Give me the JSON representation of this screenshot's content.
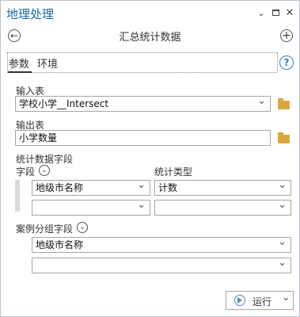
{
  "window": {
    "title": "地理处理"
  },
  "header": {
    "tool_title": "汇总统计数据"
  },
  "tabs": [
    {
      "label": "参数"
    },
    {
      "label": "环境"
    }
  ],
  "params": {
    "input_table": {
      "label": "输入表",
      "value": "学校小学__Intersect"
    },
    "output_table": {
      "label": "输出表",
      "value": "小学数量"
    },
    "stat_fields": {
      "label": "统计数据字段",
      "field_header": "字段",
      "type_header": "统计类型",
      "rows": [
        {
          "field": "地级市名称",
          "type": "计数"
        },
        {
          "field": "",
          "type": ""
        }
      ]
    },
    "case_field": {
      "label": "案例分组字段",
      "rows": [
        {
          "value": "地级市名称"
        },
        {
          "value": ""
        }
      ]
    }
  },
  "footer": {
    "run_label": "运行"
  },
  "icons": {
    "back": "back-arrow-icon",
    "add": "add-icon",
    "help": "help-icon",
    "folder": "folder-icon"
  }
}
